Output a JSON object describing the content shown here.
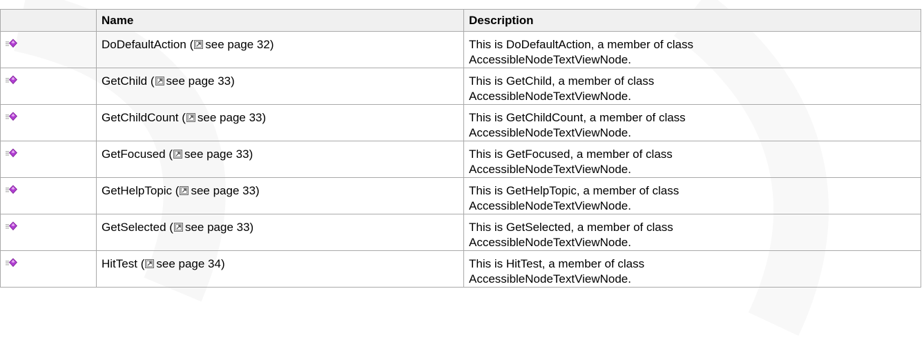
{
  "table": {
    "headers": {
      "icon": "",
      "name": "Name",
      "description": "Description"
    },
    "see_page_text": "see page",
    "rows": [
      {
        "icon": "public-method-icon",
        "name": "DoDefaultAction",
        "page": "32",
        "description_line1": "This is DoDefaultAction, a member of class",
        "description_line2": "AccessibleNodeTextViewNode."
      },
      {
        "icon": "public-method-icon",
        "name": "GetChild",
        "page": "33",
        "description_line1": "This is GetChild, a member of class",
        "description_line2": "AccessibleNodeTextViewNode."
      },
      {
        "icon": "public-method-icon",
        "name": "GetChildCount",
        "page": "33",
        "description_line1": "This is GetChildCount, a member of class",
        "description_line2": "AccessibleNodeTextViewNode."
      },
      {
        "icon": "public-method-icon",
        "name": "GetFocused",
        "page": "33",
        "description_line1": "This is GetFocused, a member of class",
        "description_line2": "AccessibleNodeTextViewNode."
      },
      {
        "icon": "public-method-icon",
        "name": "GetHelpTopic",
        "page": "33",
        "description_line1": "This is GetHelpTopic, a member of class",
        "description_line2": "AccessibleNodeTextViewNode."
      },
      {
        "icon": "public-method-icon",
        "name": "GetSelected",
        "page": "33",
        "description_line1": "This is GetSelected, a member of class",
        "description_line2": "AccessibleNodeTextViewNode."
      },
      {
        "icon": "public-method-icon",
        "name": "HitTest",
        "page": "34",
        "description_line1": "This is HitTest, a member of class",
        "description_line2": "AccessibleNodeTextViewNode."
      }
    ]
  },
  "colors": {
    "header_background": "#f0f0f0",
    "border": "#a9a9a9",
    "method_icon": "#b03fd1"
  }
}
